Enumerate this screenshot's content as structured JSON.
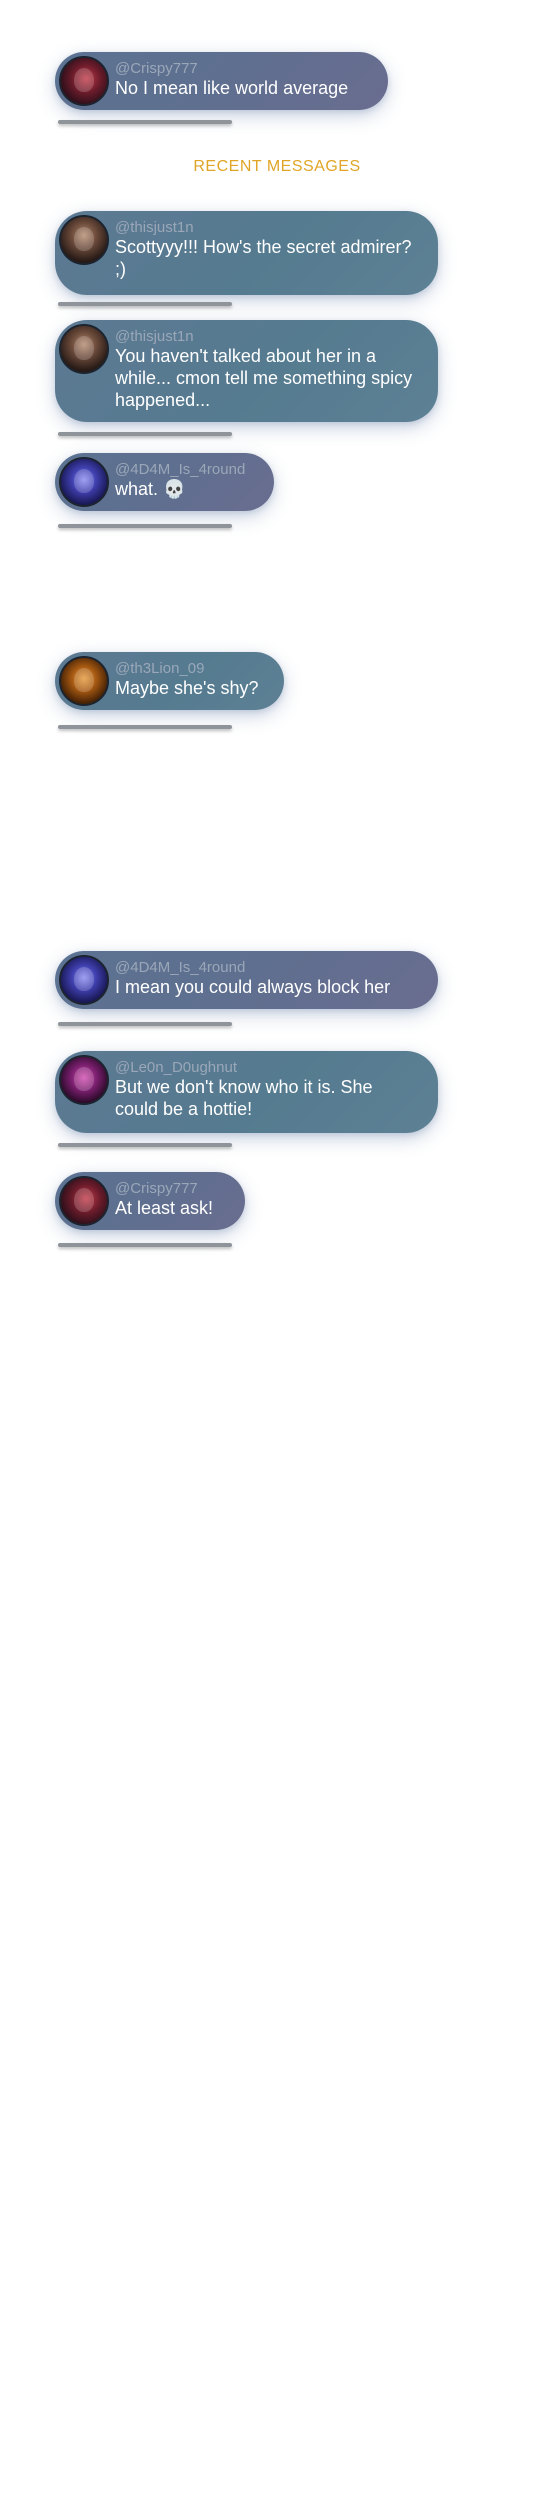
{
  "section_title": "RECENT MESSAGES",
  "pinned_message": {
    "handle": "@Crispy777",
    "text": "No I mean like world average",
    "avatar": "avatar-red-glow",
    "style": "purple"
  },
  "messages": [
    {
      "handle": "@thisjust1n",
      "text": "Scottyyy!!! How's the secret admirer? ;)",
      "avatar": "avatar-brown-portrait",
      "style": "teal"
    },
    {
      "handle": "@thisjust1n",
      "text": "You haven't talked about her in a while... cmon tell me something spicy happened...",
      "avatar": "avatar-brown-portrait",
      "style": "teal"
    },
    {
      "handle": "@4D4M_Is_4round",
      "text": "what. 💀",
      "avatar": "avatar-blue-glow",
      "style": "purple"
    },
    {
      "handle": "@th3Lion_09",
      "text": "Maybe she's shy?",
      "avatar": "avatar-orange-portrait",
      "style": "teal"
    },
    {
      "handle": "@4D4M_Is_4round",
      "text": "I mean you could always block her",
      "avatar": "avatar-blue-glow",
      "style": "purple"
    },
    {
      "handle": "@Le0n_D0ughnut",
      "text": "But we don't know who it is. She could be a hottie!",
      "avatar": "avatar-violet-portrait",
      "style": "teal"
    },
    {
      "handle": "@Crispy777",
      "text": "At least ask!",
      "avatar": "avatar-red-glow",
      "style": "purple"
    }
  ],
  "colors": {
    "accent_title": "#e0a526",
    "handle_text": "#9aa7b8",
    "bubble_teal": "#557b90",
    "bubble_purple": "#636f90",
    "divider": "#8f939a"
  }
}
